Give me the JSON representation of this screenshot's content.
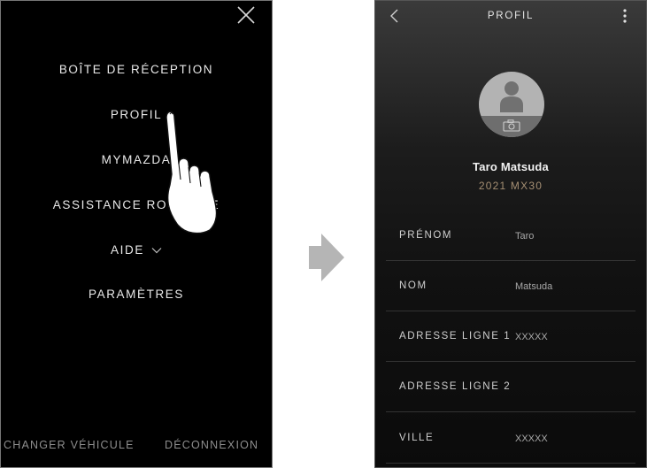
{
  "menu_screen": {
    "items": [
      {
        "label": "BOÎTE DE RÉCEPTION"
      },
      {
        "label": "PROFIL"
      },
      {
        "label": "MYMAZDA"
      },
      {
        "label": "ASSISTANCE ROUTIÈRE"
      },
      {
        "label": "AIDE"
      },
      {
        "label": "PARAMÈTRES"
      }
    ],
    "footer": {
      "change_vehicle": "CHANGER VÉHICULE",
      "logout": "DÉCONNEXION"
    }
  },
  "profile_screen": {
    "title": "PROFIL",
    "user_name": "Taro Matsuda",
    "car_model": "2021 MX30",
    "fields": [
      {
        "label": "PRÉNOM",
        "value": "Taro"
      },
      {
        "label": "NOM",
        "value": "Matsuda"
      },
      {
        "label": "ADRESSE LIGNE 1",
        "value": "XXXXX"
      },
      {
        "label": "ADRESSE LIGNE 2",
        "value": ""
      },
      {
        "label": "VILLE",
        "value": "XXXXX"
      }
    ]
  },
  "colors": {
    "menu_background": "#000000",
    "menu_text": "#e9e9e9",
    "accent_gold": "#a58f73",
    "arrow_gray": "#b5b5b5"
  },
  "icons": [
    "close-icon",
    "chevron-down-icon",
    "pointing-hand-icon",
    "arrow-right-icon",
    "back-chevron-icon",
    "more-vertical-icon",
    "person-icon",
    "camera-icon"
  ]
}
